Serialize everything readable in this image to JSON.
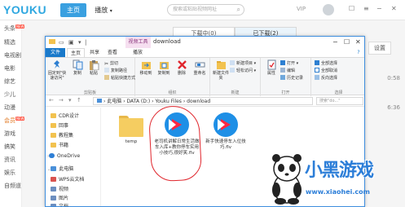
{
  "youku": {
    "logo": "YOUKU",
    "tabs": [
      "主页",
      "播放"
    ],
    "search_placeholder": "搜索或粘贴视频网址",
    "vip": "VIP",
    "download_tabs": [
      "下载中(0)",
      "已下载(2)"
    ],
    "settings": "设置",
    "row_times": [
      "0:58",
      "6:36"
    ],
    "sidebar": [
      {
        "label": "头条",
        "badge": "NEW"
      },
      {
        "label": "精选"
      },
      {
        "label": "电视剧"
      },
      {
        "label": "电影"
      },
      {
        "label": "综艺"
      },
      {
        "label": "少儿"
      },
      {
        "label": "动漫"
      },
      {
        "label": "会员",
        "badge": "NEW",
        "active": true
      },
      {
        "label": "游戏"
      },
      {
        "label": "搞笑"
      },
      {
        "label": "资讯"
      },
      {
        "label": "娱乐"
      },
      {
        "label": "自频道"
      }
    ]
  },
  "explorer": {
    "context_tab": "视频工具",
    "title": "download",
    "ribbon_tabs": [
      "文件",
      "主页",
      "共享",
      "查看",
      "播放"
    ],
    "groups": {
      "clipboard": {
        "label": "剪贴板",
        "pin": "固定到\"快速访问\"",
        "copy": "复制",
        "paste": "粘贴",
        "cut": "剪切",
        "copy_path": "复制路径",
        "paste_shortcut": "粘贴快捷方式"
      },
      "organize": {
        "label": "组织",
        "move_to": "移动到",
        "copy_to": "复制到",
        "delete": "删除",
        "rename": "重命名"
      },
      "new": {
        "label": "新建",
        "new_folder": "新建文件夹",
        "new_item": "新建项目",
        "easy_access": "轻松访问"
      },
      "open": {
        "label": "打开",
        "properties": "属性",
        "open": "打开",
        "edit": "编辑",
        "history": "历史记录"
      },
      "select": {
        "label": "选择",
        "select_all": "全部选择",
        "select_none": "全部取消",
        "invert": "反向选择"
      }
    },
    "address": {
      "path": "› 此电脑 › DATA (D:) › Youku Files › download",
      "search_placeholder": "搜索\"do...\""
    },
    "nav_pane": [
      {
        "label": "CDR设计",
        "color": "#f2c24f"
      },
      {
        "label": "回事",
        "color": "#f2c24f"
      },
      {
        "label": "教程集",
        "color": "#f2c24f"
      },
      {
        "label": "书籍",
        "color": "#f2c24f"
      },
      {
        "label": "OneDrive",
        "color": "#2e7fd6"
      },
      {
        "label": "此电脑",
        "color": "#4a90d9"
      },
      {
        "label": "WPS云文档",
        "color": "#d9534f"
      },
      {
        "label": "视频",
        "color": "#6c8ebf"
      },
      {
        "label": "图片",
        "color": "#6c8ebf"
      },
      {
        "label": "文档",
        "color": "#6c8ebf"
      }
    ],
    "files": [
      {
        "name": "temp",
        "kind": "folder"
      },
      {
        "name": "老司机讲解日常生活做车入库+教你停车实用小技巧,很好笑.flv",
        "kind": "video"
      },
      {
        "name": "新手快速停车入位技巧.flv",
        "kind": "video"
      }
    ]
  },
  "watermark": {
    "title": "小黑游戏",
    "url": "www.xiaohei.com"
  },
  "colors": {
    "youku_blue": "#2ea7e0",
    "file_tab": "#1979ca",
    "accent_red": "#e0262d",
    "watermark_blue": "#2c7ed8"
  }
}
